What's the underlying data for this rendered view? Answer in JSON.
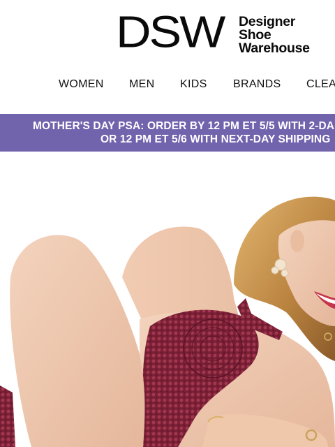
{
  "logo": {
    "mark": "DSW",
    "tagline": [
      "Designer",
      "Shoe",
      "Warehouse"
    ]
  },
  "nav": {
    "items": [
      "WOMEN",
      "MEN",
      "KIDS",
      "BRANDS",
      "CLEA"
    ]
  },
  "banner": {
    "line1": "MOTHER'S DAY PSA: ORDER BY 12 PM ET 5/5 WITH 2-DA",
    "line2": "OR 12 PM ET 5/6 WITH NEXT-DAY SHIPPING",
    "background": "#7263ad"
  },
  "hero": {
    "subject": "model in burgundy crochet top, smiling"
  }
}
